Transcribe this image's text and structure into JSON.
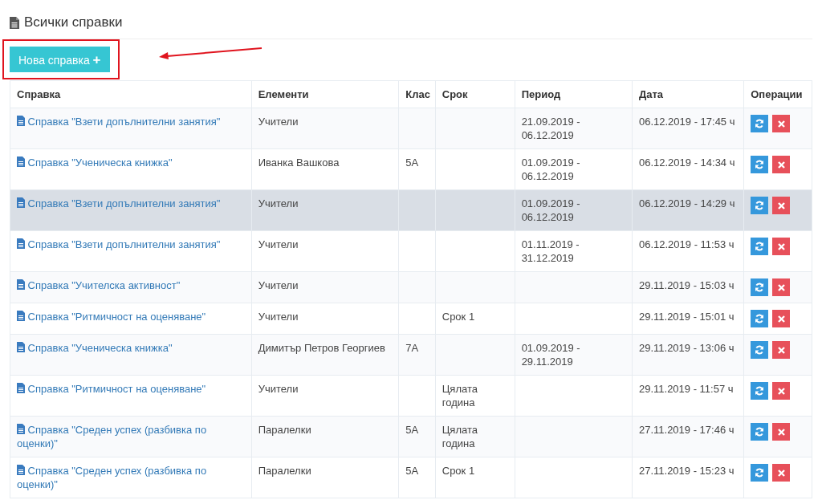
{
  "page_title": "Всички справки",
  "new_button": {
    "label": "Нова справка",
    "icon": "+"
  },
  "annotation": {
    "kind": "arrow-to-button"
  },
  "table": {
    "columns": [
      "Справка",
      "Елементи",
      "Клас",
      "Срок",
      "Период",
      "Дата",
      "Операции"
    ],
    "rows": [
      {
        "report": "Справка \"Взети допълнителни занятия\"",
        "elements": "Учители",
        "class": "",
        "term": "",
        "period": "21.09.2019 - 06.12.2019",
        "date": "06.12.2019 - 17:45 ч",
        "selected": false
      },
      {
        "report": "Справка \"Ученическа книжка\"",
        "elements": "Иванка Вашкова",
        "class": "5А",
        "term": "",
        "period": "01.09.2019 - 06.12.2019",
        "date": "06.12.2019 - 14:34 ч",
        "selected": false
      },
      {
        "report": "Справка \"Взети допълнителни занятия\"",
        "elements": "Учители",
        "class": "",
        "term": "",
        "period": "01.09.2019 - 06.12.2019",
        "date": "06.12.2019 - 14:29 ч",
        "selected": true
      },
      {
        "report": "Справка \"Взети допълнителни занятия\"",
        "elements": "Учители",
        "class": "",
        "term": "",
        "period": "01.11.2019 - 31.12.2019",
        "date": "06.12.2019 - 11:53 ч",
        "selected": false
      },
      {
        "report": "Справка \"Учителска активност\"",
        "elements": "Учители",
        "class": "",
        "term": "",
        "period": "",
        "date": "29.11.2019 - 15:03 ч",
        "selected": false
      },
      {
        "report": "Справка \"Ритмичност на оценяване\"",
        "elements": "Учители",
        "class": "",
        "term": "Срок 1",
        "period": "",
        "date": "29.11.2019 - 15:01 ч",
        "selected": false
      },
      {
        "report": "Справка \"Ученическа книжка\"",
        "elements": "Димитър Петров Георгиев",
        "class": "7А",
        "term": "",
        "period": "01.09.2019 - 29.11.2019",
        "date": "29.11.2019 - 13:06 ч",
        "selected": false
      },
      {
        "report": "Справка \"Ритмичност на оценяване\"",
        "elements": "Учители",
        "class": "",
        "term": "Цялата година",
        "period": "",
        "date": "29.11.2019 - 11:57 ч",
        "selected": false
      },
      {
        "report": "Справка \"Среден успех (разбивка по оценки)\"",
        "elements": "Паралелки",
        "class": "5А",
        "term": "Цялата година",
        "period": "",
        "date": "27.11.2019 - 17:46 ч",
        "selected": false
      },
      {
        "report": "Справка \"Среден успех (разбивка по оценки)\"",
        "elements": "Паралелки",
        "class": "5А",
        "term": "Срок 1",
        "period": "",
        "date": "27.11.2019 - 15:23 ч",
        "selected": false
      }
    ]
  }
}
